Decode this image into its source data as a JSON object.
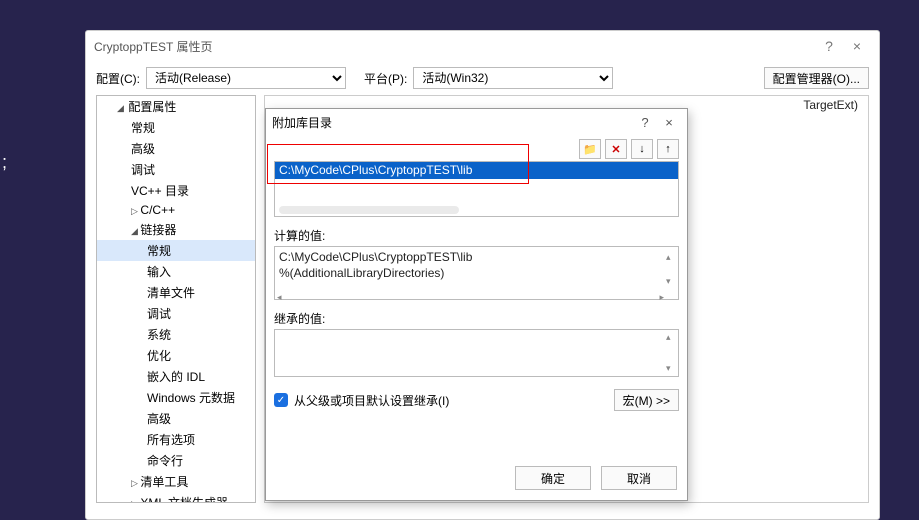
{
  "colors": {
    "selection": "#0a62c9",
    "redbox": "#e00000",
    "checkbox": "#1a6fe0"
  },
  "main": {
    "title": "CryptoppTEST 属性页",
    "help": "?",
    "close": "×",
    "config_label": "配置(C):",
    "config_value": "活动(Release)",
    "platform_label": "平台(P):",
    "platform_value": "活动(Win32)",
    "config_mgr": "配置管理器(O)...",
    "target_ext": "TargetExt)"
  },
  "tree": {
    "root": "配置属性",
    "items": [
      "常规",
      "高级",
      "调试",
      "VC++ 目录"
    ],
    "cpp_node": "C/C++",
    "linker_node": "链接器",
    "linker_children": [
      "常规",
      "输入",
      "清单文件",
      "调试",
      "系统",
      "优化",
      "嵌入的 IDL",
      "Windows 元数据",
      "高级",
      "所有选项",
      "命令行"
    ],
    "after_linker": [
      "清单工具",
      "XML 文档生成器"
    ]
  },
  "popup": {
    "title": "附加库目录",
    "help": "?",
    "close": "×",
    "toolbar": {
      "newfolder": "📁",
      "delete": "✕",
      "down": "↓",
      "up": "↑"
    },
    "path": "C:\\MyCode\\CPlus\\CryptoppTEST\\lib",
    "computed_label": "计算的值:",
    "computed_lines": [
      "C:\\MyCode\\CPlus\\CryptoppTEST\\lib",
      "%(AdditionalLibraryDirectories)"
    ],
    "inherited_label": "继承的值:",
    "inherit_checkbox": "从父级或项目默认设置继承(I)",
    "macro_btn": "宏(M) >>",
    "ok": "确定",
    "cancel": "取消"
  }
}
